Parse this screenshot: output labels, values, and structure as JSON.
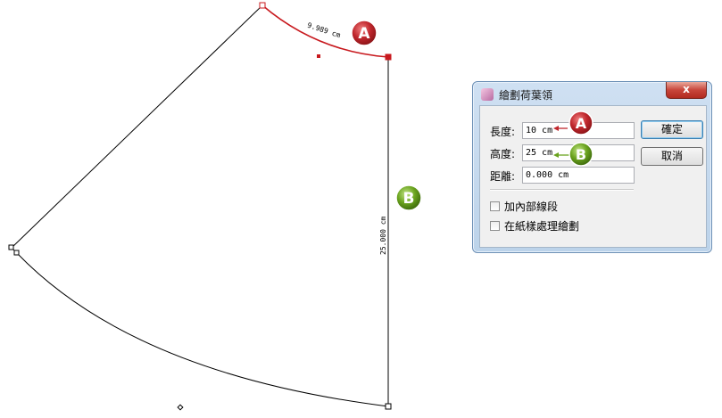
{
  "drawing": {
    "arc_length_label": "9.989 cm",
    "height_label": "25.000 cm",
    "badge_a": "A",
    "badge_b": "B"
  },
  "dialog": {
    "title": "繪劃荷葉領",
    "close_label": "x",
    "fields": [
      {
        "label": "長度:",
        "value": "10 cm"
      },
      {
        "label": "高度:",
        "value": "25 cm"
      },
      {
        "label": "距離:",
        "value": "0.000 cm"
      }
    ],
    "ok_label": "確定",
    "cancel_label": "取消",
    "checkbox_inner_lines": {
      "label": "加內部線段",
      "checked": false
    },
    "checkbox_paper_pattern": {
      "label": "在紙樣處理繪劃",
      "checked": false
    },
    "callout_a": "A",
    "callout_b": "B"
  },
  "colors": {
    "arc_red": "#c8191e",
    "badge_red": "#c0272d",
    "badge_green": "#6aa31e"
  }
}
